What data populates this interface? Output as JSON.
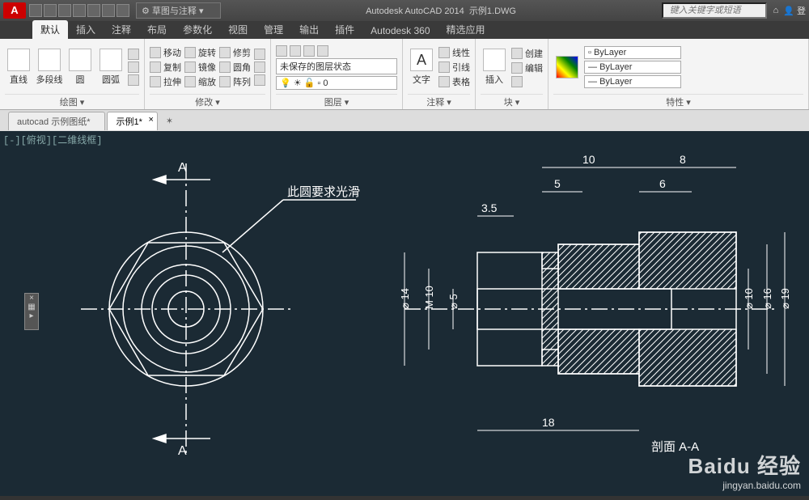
{
  "titlebar": {
    "app_name": "Autodesk AutoCAD 2014",
    "doc_name": "示例1.DWG",
    "workspace": "草图与注释",
    "search_placeholder": "键入关键字或短语",
    "login_label": "登"
  },
  "tabs": [
    "默认",
    "插入",
    "注释",
    "布局",
    "参数化",
    "视图",
    "管理",
    "输出",
    "插件",
    "Autodesk 360",
    "精选应用"
  ],
  "active_tab": 0,
  "ribbon": {
    "draw": {
      "label": "绘图",
      "line": "直线",
      "pline": "多段线",
      "circle": "圆",
      "arc": "圆弧"
    },
    "modify": {
      "label": "修改",
      "move": "移动",
      "rotate": "旋转",
      "trim": "修剪",
      "copy": "复制",
      "mirror": "镜像",
      "fillet": "圆角",
      "stretch": "拉伸",
      "scale": "缩放",
      "array": "阵列"
    },
    "layer": {
      "label": "图层",
      "state": "未保存的图层状态",
      "current": "0"
    },
    "annot": {
      "label": "注释",
      "text": "文字",
      "linear": "线性",
      "leader": "引线",
      "table": "表格"
    },
    "block": {
      "label": "块",
      "insert": "插入",
      "create": "创建",
      "edit": "编辑"
    },
    "props": {
      "label": "特性",
      "bylayer": "ByLayer",
      "bylayer2": "ByLayer",
      "bylayer3": "ByLayer"
    }
  },
  "doctabs": {
    "t1": "autocad 示例图纸*",
    "t2": "示例1*"
  },
  "view_label": "[-][俯视][二维线框]",
  "drawing": {
    "section_a": "A",
    "note": "此圆要求光滑",
    "dims": {
      "d10": "10",
      "d8": "8",
      "d5": "5",
      "d6": "6",
      "d3_5": "3.5",
      "d18": "18"
    },
    "dia": {
      "p14": "⌀ 14",
      "m10": "M 10",
      "p5": "⌀ 5",
      "p10": "⌀ 10",
      "p16": "⌀ 16",
      "p19": "⌀ 19"
    },
    "section_label": "剖面 A-A"
  },
  "watermark": {
    "brand": "Baidu 经验",
    "url": "jingyan.baidu.com"
  }
}
